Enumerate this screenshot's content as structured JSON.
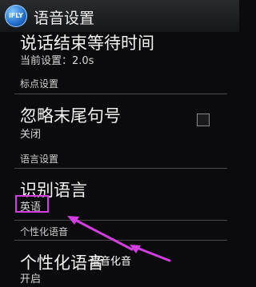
{
  "app_bar": {
    "icon_text": "iFLY",
    "title": "语音设置"
  },
  "prefs": {
    "wait_time": {
      "title": "说话结束等待时间",
      "summary": "当前设置：2.0s"
    },
    "punct_header": "标点设置",
    "ignore_punct": {
      "title": "忽略末尾句号",
      "summary": "关闭",
      "checked": false
    },
    "lang_header": "语言设置",
    "recognize_lang": {
      "title": "识别语言",
      "summary": "英语"
    },
    "personal_header": "个性化语音",
    "personal_voice": {
      "title": "个性化语音",
      "summary": "开启"
    }
  },
  "annotation": {
    "overlay_text": "语音化音",
    "color": "#d23ee0"
  }
}
